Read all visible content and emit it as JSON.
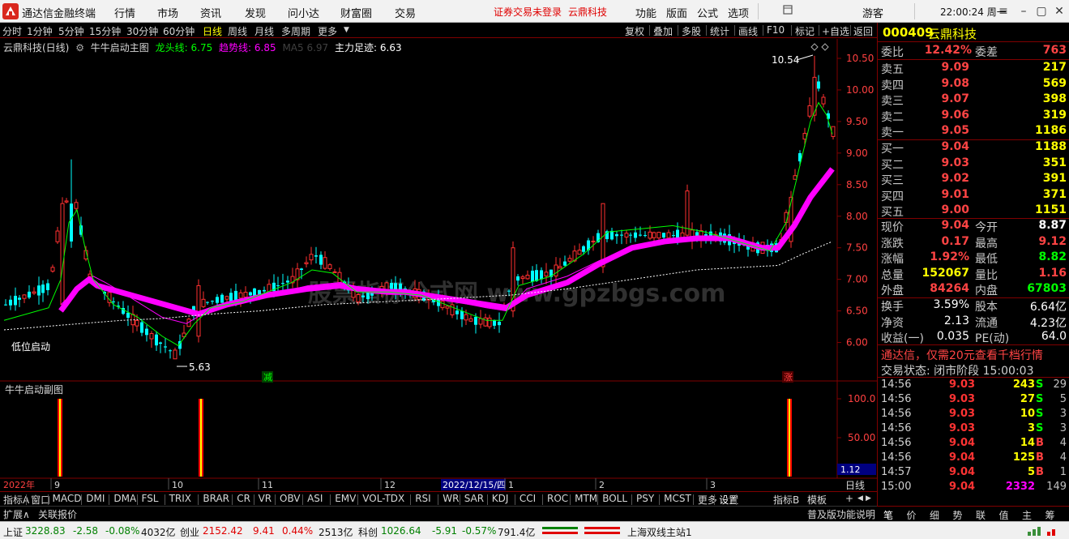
{
  "app": {
    "title": "通达信金融终端",
    "menus": [
      "行情",
      "市场",
      "资讯",
      "发现",
      "问小达",
      "财富圈",
      "交易"
    ],
    "warning": "证券交易未登录",
    "stock_name_top": "云鼎科技",
    "right_menus": [
      "功能",
      "版面",
      "公式",
      "选项"
    ],
    "user": "游客",
    "clock": "22:00:24 周一"
  },
  "periods": [
    "分时",
    "1分钟",
    "5分钟",
    "15分钟",
    "30分钟",
    "60分钟",
    "日线",
    "周线",
    "月线",
    "多周期",
    "更多"
  ],
  "active_period": "日线",
  "toolbar_right": [
    "复权",
    "叠加",
    "多股",
    "统计",
    "画线",
    "F10",
    "标记",
    "+自选",
    "返回"
  ],
  "chart_header": {
    "name": "云鼎科技(日线)",
    "formula": "牛牛启动主图",
    "dragon_label": "龙头线: 6.75",
    "trend_label": "趋势线: 6.85",
    "ma_label": "MA5 6.97",
    "main_label": "主力足迹: 6.63",
    "colors": {
      "dragon": "#00ff00",
      "trend": "#ff00ff",
      "ma": "#404040",
      "main": "#ffffff"
    }
  },
  "annotations": {
    "high": "10.54",
    "low": "5.63",
    "start": "低位启动",
    "down_tag": "减",
    "up_tag": "涨"
  },
  "sub_header": "牛牛启动副图",
  "sub_axis": [
    "100.0",
    "50.00"
  ],
  "sub_value": "1.12",
  "price_axis": [
    "10.50",
    "10.00",
    "9.50",
    "9.00",
    "8.50",
    "8.00",
    "7.50",
    "7.00",
    "6.50",
    "6.00"
  ],
  "date_axis": [
    "2022年",
    "9",
    "10",
    "11",
    "12",
    "2022/12/15/四",
    "1",
    "2",
    "3"
  ],
  "date_axis_right": "日线",
  "chart_data": {
    "type": "candlestick",
    "title": "云鼎科技(日线)",
    "ylim": [
      5.5,
      10.7
    ],
    "y_ticks": [
      6.0,
      6.5,
      7.0,
      7.5,
      8.0,
      8.5,
      9.0,
      9.5,
      10.0,
      10.5
    ],
    "annotated_high": 10.54,
    "annotated_low": 5.63,
    "sub_chart_ylim": [
      0,
      110
    ],
    "sub_chart_ticks": [
      50,
      100
    ],
    "sub_chart_signals": [
      100,
      100,
      100
    ],
    "colors": {
      "up": "#ff3030",
      "down": "#00ffff",
      "trend": "#ff00ff",
      "dragon": "#00ff00",
      "main": "#ffffff"
    }
  },
  "indicator_tabs": [
    "指标A",
    "窗口",
    "MACD",
    "DMI",
    "DMA",
    "FSL",
    "TRIX",
    "BRAR",
    "CR",
    "VR",
    "OBV",
    "ASI",
    "EMV",
    "VOL-TDX",
    "RSI",
    "WR",
    "SAR",
    "KDJ",
    "CCI",
    "ROC",
    "MTM",
    "BOLL",
    "PSY",
    "MCST",
    "更多",
    "设置"
  ],
  "indicator_tabs_right": [
    "指标B",
    "模板"
  ],
  "ext_tabs": [
    "扩展∧",
    "关联报价"
  ],
  "ext_right": "普及版功能说明",
  "quote": {
    "code": "000409",
    "name": "云鼎科技",
    "ratio_label": "委比",
    "ratio": "12.42%",
    "diff_label": "委差",
    "diff": "763",
    "asks": [
      {
        "label": "卖五",
        "price": "9.09",
        "vol": "217"
      },
      {
        "label": "卖四",
        "price": "9.08",
        "vol": "569"
      },
      {
        "label": "卖三",
        "price": "9.07",
        "vol": "398"
      },
      {
        "label": "卖二",
        "price": "9.06",
        "vol": "319"
      },
      {
        "label": "卖一",
        "price": "9.05",
        "vol": "1186"
      }
    ],
    "bids": [
      {
        "label": "买一",
        "price": "9.04",
        "vol": "1188"
      },
      {
        "label": "买二",
        "price": "9.03",
        "vol": "351"
      },
      {
        "label": "买三",
        "price": "9.02",
        "vol": "391"
      },
      {
        "label": "买四",
        "price": "9.01",
        "vol": "371"
      },
      {
        "label": "买五",
        "price": "9.00",
        "vol": "1151"
      }
    ],
    "stats": [
      {
        "l1": "现价",
        "v1": "9.04",
        "l2": "今开",
        "v2": "8.87"
      },
      {
        "l1": "涨跌",
        "v1": "0.17",
        "l2": "最高",
        "v2": "9.12"
      },
      {
        "l1": "涨幅",
        "v1": "1.92%",
        "l2": "最低",
        "v2": "8.82"
      },
      {
        "l1": "总量",
        "v1": "152067",
        "l2": "量比",
        "v2": "1.16"
      },
      {
        "l1": "外盘",
        "v1": "84264",
        "l2": "内盘",
        "v2": "67803"
      }
    ],
    "stats2": [
      {
        "l1": "换手",
        "v1": "3.59%",
        "l2": "股本",
        "v2": "6.64亿"
      },
      {
        "l1": "净资",
        "v1": "2.13",
        "l2": "流通",
        "v2": "4.23亿"
      },
      {
        "l1": "收益(一)",
        "v1": "0.035",
        "l2": "PE(动)",
        "v2": "64.0"
      }
    ],
    "promo": "通达信，仅需20元查看千档行情",
    "trade_state": "交易状态: 闭市阶段 15:00:03",
    "ticks": [
      {
        "t": "14:56",
        "p": "9.03",
        "v": "243",
        "s": "S",
        "n": "29"
      },
      {
        "t": "14:56",
        "p": "9.03",
        "v": "27",
        "s": "S",
        "n": "5"
      },
      {
        "t": "14:56",
        "p": "9.03",
        "v": "10",
        "s": "S",
        "n": "3"
      },
      {
        "t": "14:56",
        "p": "9.03",
        "v": "3",
        "s": "S",
        "n": "3"
      },
      {
        "t": "14:56",
        "p": "9.04",
        "v": "14",
        "s": "B",
        "n": "4"
      },
      {
        "t": "14:56",
        "p": "9.04",
        "v": "125",
        "s": "B",
        "n": "4"
      },
      {
        "t": "14:57",
        "p": "9.04",
        "v": "5",
        "s": "B",
        "n": "1"
      },
      {
        "t": "15:00",
        "p": "9.04",
        "v": "2332",
        "s": "",
        "n": "149"
      }
    ],
    "tabs": [
      "笔",
      "价",
      "细",
      "势",
      "联",
      "值",
      "主",
      "筹"
    ]
  },
  "status": {
    "sh_label": "上证",
    "sh_val": "3228.83",
    "sh_chg": "-2.58",
    "sh_pct": "-0.08%",
    "sh_amt": "4032亿",
    "cy_label": "创业",
    "cy_val": "2152.42",
    "cy_chg": "9.41",
    "cy_pct": "0.44%",
    "cy_amt": "2513亿",
    "kc_label": "科创",
    "kc_val": "1026.64",
    "kc_chg": "-5.91",
    "kc_pct": "-0.57%",
    "kc_amt": "791.4亿",
    "server": "上海双线主站1"
  }
}
